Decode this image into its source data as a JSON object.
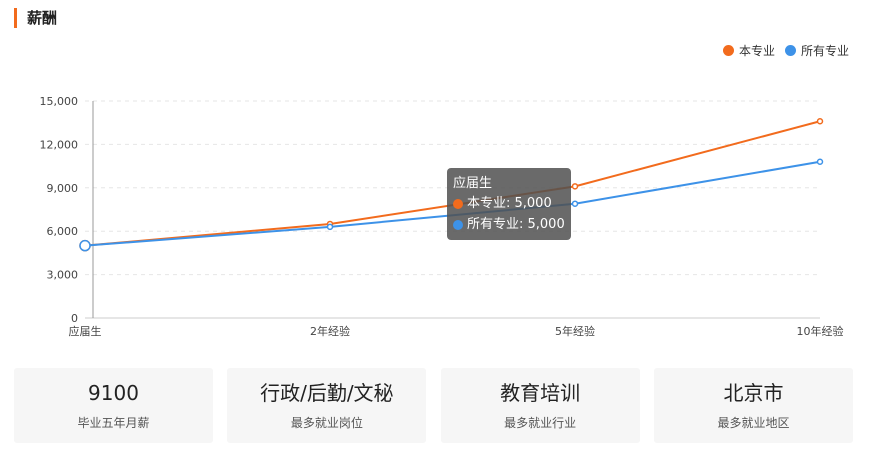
{
  "section": {
    "title": "薪酬"
  },
  "chart_data": {
    "type": "line",
    "categories": [
      "应届生",
      "2年经验",
      "5年经验",
      "10年经验"
    ],
    "series": [
      {
        "name": "本专业",
        "color": "#f26b1d",
        "values": [
          5000,
          6500,
          9100,
          13600
        ]
      },
      {
        "name": "所有专业",
        "color": "#3d92e8",
        "values": [
          5000,
          6300,
          7900,
          10800
        ]
      }
    ],
    "yticks": [
      "0",
      "3,000",
      "6,000",
      "9,000",
      "12,000",
      "15,000"
    ],
    "ylim": [
      0,
      15000
    ],
    "grid": true,
    "legend_position": "top-right",
    "tooltip": {
      "title": "应届生",
      "rows": [
        "本专业: 5,000",
        "所有专业: 5,000"
      ]
    }
  },
  "cards": [
    {
      "value": "9100",
      "label": "毕业五年月薪"
    },
    {
      "value": "行政/后勤/文秘",
      "label": "最多就业岗位"
    },
    {
      "value": "教育培训",
      "label": "最多就业行业"
    },
    {
      "value": "北京市",
      "label": "最多就业地区"
    }
  ]
}
